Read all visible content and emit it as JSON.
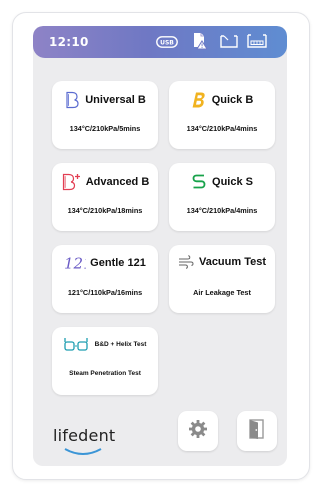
{
  "status_bar": {
    "time": "12:10",
    "icons": [
      "usb-icon",
      "warning-document-icon",
      "open-tray-icon",
      "battery-tray-icon"
    ]
  },
  "programs": [
    {
      "id": "universal-b",
      "title": "Universal B",
      "subtitle": "134°C/210kPa/5mins",
      "icon": "letter-b-outline-icon",
      "icon_color": "#5a6bd0"
    },
    {
      "id": "quick-b",
      "title": "Quick B",
      "subtitle": "134°C/210kPa/4mins",
      "icon": "letter-b-fast-icon",
      "icon_color": "#f1b320"
    },
    {
      "id": "advanced-b",
      "title": "Advanced B",
      "subtitle": "134°C/210kPa/18mins",
      "icon": "letter-b-plus-icon",
      "icon_color": "#e23d52"
    },
    {
      "id": "quick-s",
      "title": "Quick S",
      "subtitle": "134°C/210kPa/4mins",
      "icon": "letter-s-icon",
      "icon_color": "#17a24a"
    },
    {
      "id": "gentle-121",
      "title": "Gentle 121",
      "subtitle": "121°C/110kPa/16mins",
      "icon": "numeral-121-icon",
      "icon_color": "#6a5bc5"
    },
    {
      "id": "vacuum-test",
      "title": "Vacuum Test",
      "subtitle": "Air Leakage Test",
      "icon": "air-wind-icon",
      "icon_color": "#666666"
    },
    {
      "id": "bd-helix-test",
      "title": "B&D + Helix Test",
      "subtitle": "Steam Penetration Test",
      "icon": "bd-helix-icon",
      "icon_color": "#1d9db0"
    }
  ],
  "footer": {
    "logo_text": "lifedent",
    "settings_icon": "gear-icon",
    "exit_icon": "exit-door-icon"
  }
}
